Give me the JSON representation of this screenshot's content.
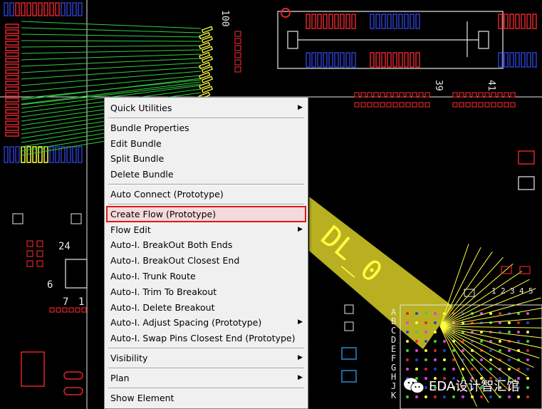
{
  "canvas": {
    "ruler_labels": [
      "100",
      "39",
      "41",
      "24",
      "7",
      "1",
      "6"
    ],
    "pin_letters": [
      "A",
      "B",
      "C",
      "D",
      "E",
      "F",
      "G",
      "H",
      "J",
      "K"
    ],
    "pin_numbers_top": [
      "1",
      "2",
      "3",
      "4",
      "5"
    ],
    "bundle_label": "DL_0",
    "colors": {
      "background": "#000000",
      "pin_red": "#e0242a",
      "pin_blue": "#2a3ec8",
      "pin_yellow": "#ffff40",
      "net_green": "#30d040",
      "bundle": "#b8b020",
      "outline_white": "#e8e8e8"
    }
  },
  "context_menu": {
    "items": [
      {
        "label": "Quick Utilities",
        "submenu": true
      },
      {
        "label": "Bundle Properties",
        "submenu": false
      },
      {
        "label": "Edit Bundle",
        "submenu": false
      },
      {
        "label": "Split Bundle",
        "submenu": false
      },
      {
        "label": "Delete Bundle",
        "submenu": false
      },
      {
        "label": "Auto Connect (Prototype)",
        "submenu": false
      },
      {
        "label": "Create Flow (Prototype)",
        "submenu": false,
        "highlighted": true
      },
      {
        "label": "Flow Edit",
        "submenu": true
      },
      {
        "label": "Auto-I. BreakOut Both Ends",
        "submenu": false
      },
      {
        "label": "Auto-I. BreakOut Closest End",
        "submenu": false
      },
      {
        "label": "Auto-I. Trunk Route",
        "submenu": false
      },
      {
        "label": "Auto-I. Trim To Breakout",
        "submenu": false
      },
      {
        "label": "Auto-I. Delete Breakout",
        "submenu": false
      },
      {
        "label": "Auto-I. Adjust Spacing (Prototype)",
        "submenu": true
      },
      {
        "label": "Auto-I. Swap Pins Closest End (Prototype)",
        "submenu": false
      },
      {
        "label": "Visibility",
        "submenu": true
      },
      {
        "label": "Plan",
        "submenu": true
      },
      {
        "label": "Show Element",
        "submenu": false
      }
    ],
    "submenu_arrow": "▶",
    "highlight_color": "#e01616"
  },
  "watermark": {
    "text": "EDA设计智汇馆",
    "icon": "wechat-icon"
  }
}
